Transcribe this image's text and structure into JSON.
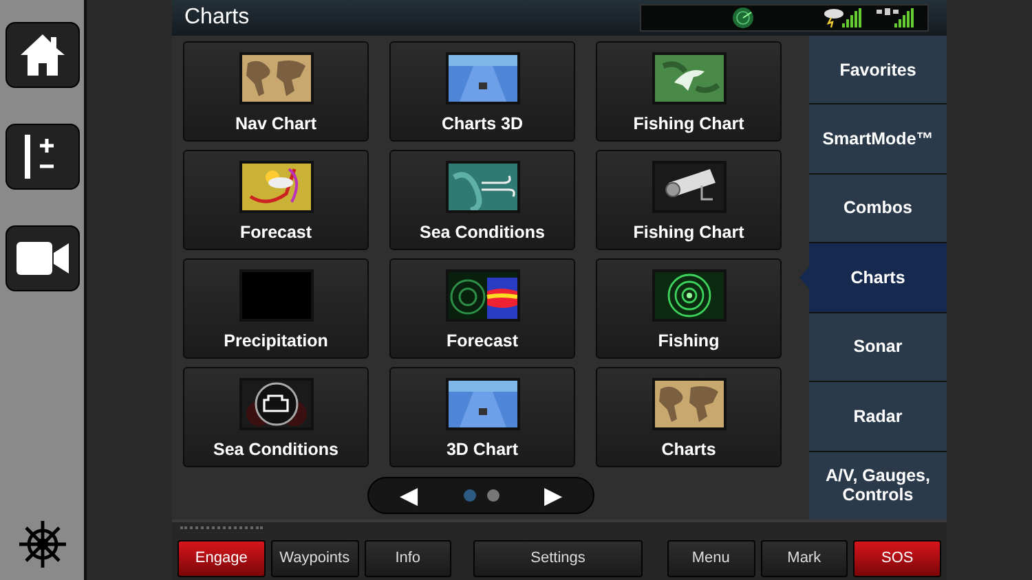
{
  "window": {
    "title": "Charts"
  },
  "side_rail": [
    {
      "kind": "home"
    },
    {
      "kind": "zoom"
    },
    {
      "kind": "camera"
    },
    {
      "kind": "helm"
    }
  ],
  "tiles": [
    {
      "label": "Nav Chart",
      "kind": "map"
    },
    {
      "label": "Charts 3D",
      "kind": "road3d"
    },
    {
      "label": "Fishing Chart",
      "kind": "fish"
    },
    {
      "label": "Forecast",
      "kind": "weather"
    },
    {
      "label": "Sea Conditions",
      "kind": "wind"
    },
    {
      "label": "Fishing Chart",
      "kind": "camera"
    },
    {
      "label": "Precipitation",
      "kind": "blank"
    },
    {
      "label": "Forecast",
      "kind": "sonar"
    },
    {
      "label": "Fishing",
      "kind": "radar"
    },
    {
      "label": "Sea Conditions",
      "kind": "engine"
    },
    {
      "label": "3D Chart",
      "kind": "road3d"
    },
    {
      "label": "Charts",
      "kind": "map"
    }
  ],
  "pager": {
    "prev": "◀",
    "next": "▶",
    "pages": [
      {
        "selected": true
      },
      {
        "selected": false
      }
    ]
  },
  "nav": [
    {
      "label": "Favorites",
      "selected": false
    },
    {
      "label": "SmartMode™",
      "selected": false
    },
    {
      "label": "Combos",
      "selected": false
    },
    {
      "label": "Charts",
      "selected": true
    },
    {
      "label": "Sonar",
      "selected": false
    },
    {
      "label": "Radar",
      "selected": false
    },
    {
      "label": "A/V, Gauges, Controls",
      "selected": false
    }
  ],
  "buttons": [
    {
      "label": "Engage",
      "kind": "alert"
    },
    {
      "label": "Waypoints",
      "kind": "normal"
    },
    {
      "label": "Info",
      "kind": "normal"
    },
    {
      "label": "Settings",
      "kind": "wide"
    },
    {
      "label": "Menu",
      "kind": "normal"
    },
    {
      "label": "Mark",
      "kind": "normal"
    },
    {
      "label": "SOS",
      "kind": "alert"
    }
  ]
}
